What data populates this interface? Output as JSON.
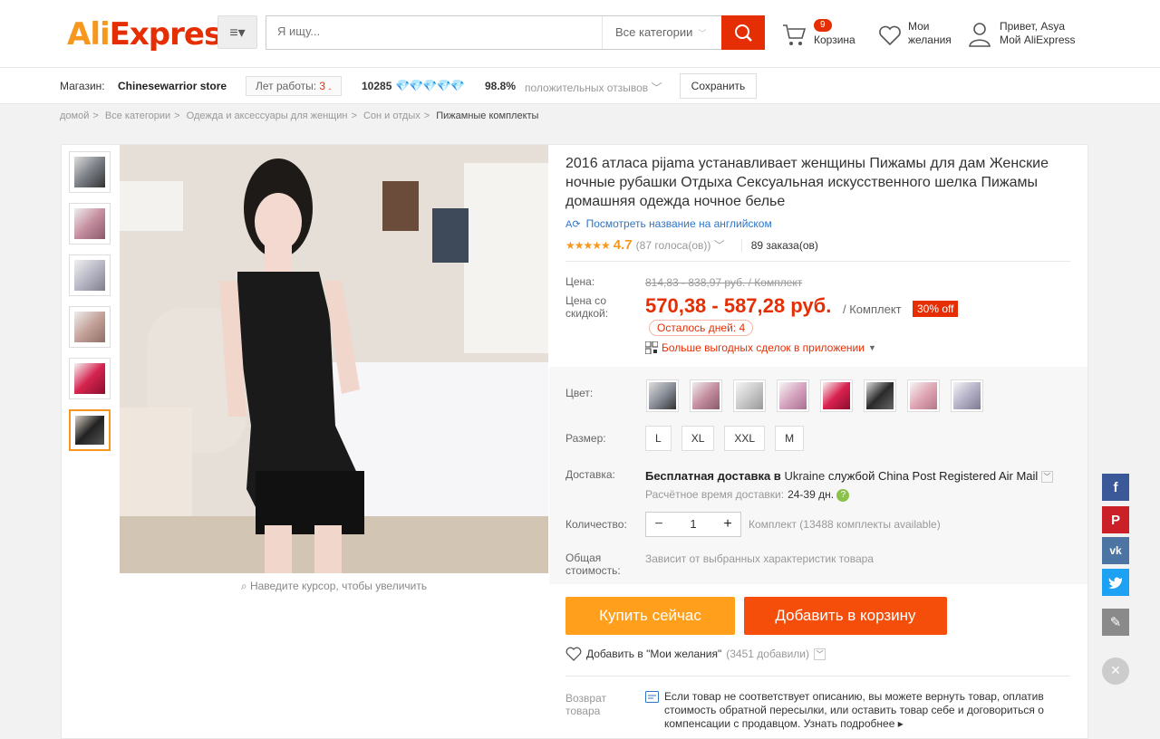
{
  "header": {
    "logo_text": "AliExpress",
    "search_placeholder": "Я ищу...",
    "category_select": "Все категории",
    "cart_count": "9",
    "cart_label": "Корзина",
    "wishlist_line1": "Мои",
    "wishlist_line2": "желания",
    "account_line1": "Привет, Asya",
    "account_line2": "Мой AliExpress"
  },
  "store": {
    "label": "Магазин:",
    "name": "Chinesewarrior store",
    "years_label": "Лет работы:",
    "years_value": "3 .",
    "score": "10285",
    "diamonds": "💎💎💎💎💎",
    "positive_pct": "98.8%",
    "positive_label": "положительных отзывов",
    "save_button": "Сохранить"
  },
  "breadcrumbs": [
    "домой",
    "Все категории",
    "Одежда и аксессуары для женщин",
    "Сон и отдых",
    "Пижамные комплекты"
  ],
  "gallery": {
    "zoom_hint": "Наведите курсор, чтобы увеличить",
    "thumb_colors": [
      "#7a7f86",
      "#c58fa0",
      "#b8b8c6",
      "#c4a29a",
      "#d5244f",
      "#222222"
    ]
  },
  "product": {
    "title": "2016 атласа pijama устанавливает женщины Пижамы для дам Женские ночные рубашки Отдыха Сексуальная искусственного шелка Пижамы домашняя одежда ночное белье",
    "translate_link": "Посмотреть название на английском",
    "rating": "4.7",
    "votes": "(87 голоса(ов))",
    "orders": "89 заказа(ов)"
  },
  "price": {
    "label": "Цена:",
    "old": "814,83 - 838,97 руб. / Комплект",
    "discount_label_1": "Цена со",
    "discount_label_2": "скидкой:",
    "new": "570,38 - 587,28 руб.",
    "unit": "/ Комплект",
    "off_badge": "30% off",
    "days_left": "Осталось дней: 4",
    "app_deals": "Больше выгодных сделок в приложении"
  },
  "options": {
    "color_label": "Цвет:",
    "color_swatches": [
      "#8a8f99",
      "#c58fa0",
      "#c9c9c9",
      "#d6a5c0",
      "#d9214f",
      "#2a2a2a",
      "#e0a7b5",
      "#b5b2c8"
    ],
    "size_label": "Размер:",
    "sizes": [
      "L",
      "XL",
      "XXL",
      "M"
    ],
    "shipping_label": "Доставка:",
    "shipping_main": "Бесплатная доставка в",
    "shipping_country": "Ukraine",
    "shipping_service": "службой China Post Registered Air Mail",
    "shipping_time_label": "Расчётное время доставки:",
    "shipping_time": "24-39 дн.",
    "qty_label": "Количество:",
    "qty_value": "1",
    "qty_available": "Комплект (13488 комплекты available)",
    "total_label_1": "Общая",
    "total_label_2": "стоимость:",
    "total_text": "Зависит от выбранных характеристик товара"
  },
  "actions": {
    "buy_now": "Купить сейчас",
    "add_to_cart": "Добавить в корзину",
    "add_wish": "Добавить в \"Мои желания\"",
    "wish_count": "(3451 добавили)"
  },
  "returns": {
    "label_1": "Возврат",
    "label_2": "товара",
    "text": "Если товар не соответствует описанию, вы можете вернуть товар, оплатив стоимость обратной пересылки, или оставить товар себе и договориться о компенсации с продавцом.",
    "more": "Узнать подробнее"
  },
  "share": {
    "facebook_color": "#3b5998",
    "pinterest_color": "#cb2027",
    "vk_color": "#4c75a3",
    "twitter_color": "#1da1f2",
    "edit_color": "#8a8a8a"
  }
}
